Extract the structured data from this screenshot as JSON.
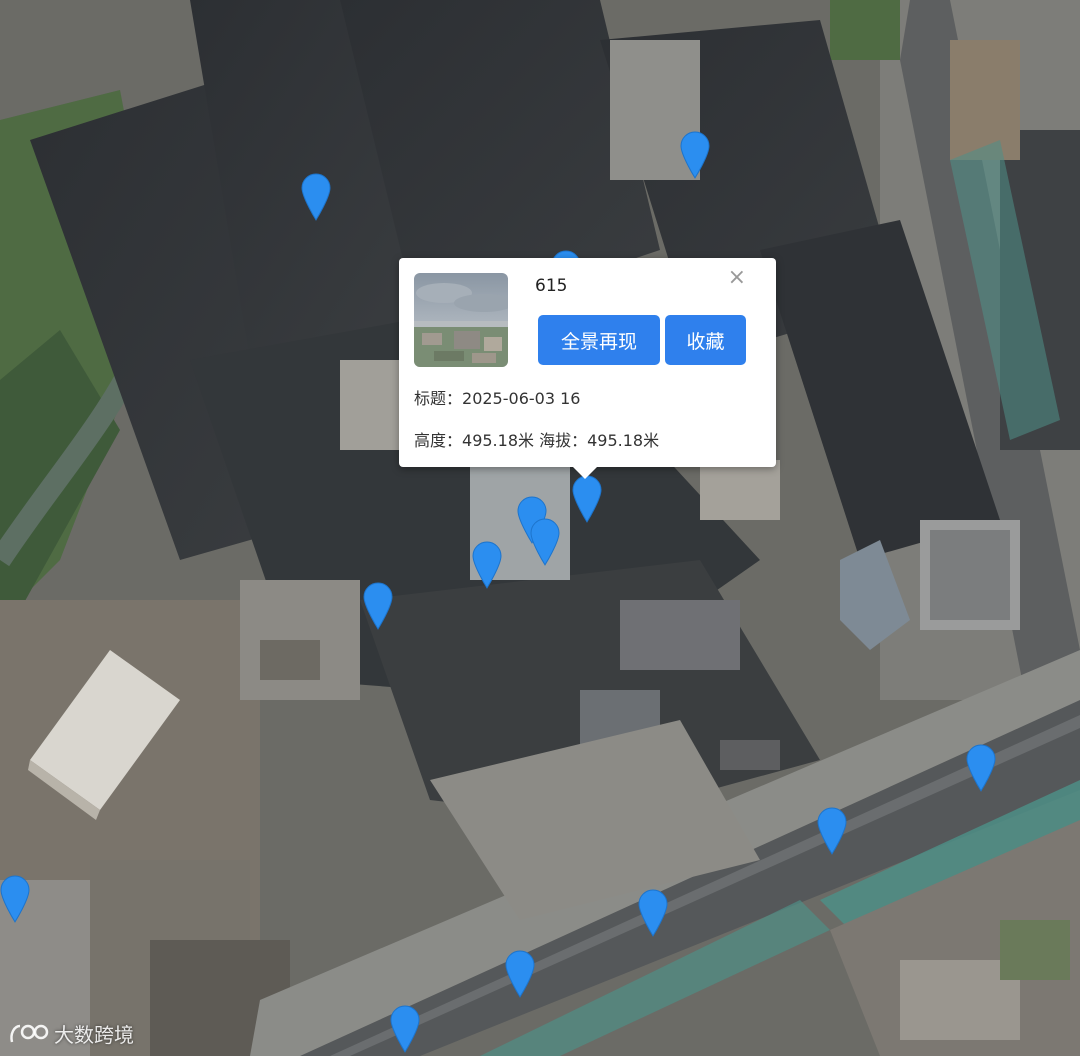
{
  "popup": {
    "id": "615",
    "close_glyph": "×",
    "pano_button": "全景再现",
    "fav_button": "收藏",
    "title_label": "标题：",
    "title_value": "2025-06-03 16",
    "height_label": "高度：",
    "height_value": "495.18米",
    "altitude_label": "海拔：",
    "altitude_value": "495.18米"
  },
  "logo": {
    "text": "大数跨境",
    "icon": "logo-icon"
  },
  "markers": {
    "count": 16,
    "color": "#2b8ef0",
    "icon": "map-pin-icon"
  },
  "colors": {
    "accent": "#2f80ed"
  }
}
